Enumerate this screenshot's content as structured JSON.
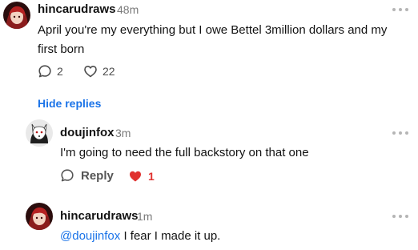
{
  "comments": [
    {
      "username": "hincarudraws",
      "time": "48m",
      "text": "April you're my everything but I owe Bettel 3million dollars and my first born",
      "reply_count": "2",
      "like_count": "22",
      "avatar_icon": "avatar-anime-red-hair"
    },
    {
      "username": "doujinfox",
      "time": "3m",
      "text": "I'm going to need the full backstory on that one",
      "reply_label": "Reply",
      "like_count": "1",
      "liked": true,
      "avatar_icon": "avatar-white-fox"
    },
    {
      "username": "hincarudraws",
      "time": "1m",
      "mention": "@doujinfox",
      "text": " I fear I made it up.",
      "avatar_icon": "avatar-anime-red-hair"
    }
  ],
  "thread": {
    "hide_replies_label": "Hide replies"
  },
  "colors": {
    "link": "#1a73e8",
    "liked": "#e0312f",
    "muted": "#7a7a7a"
  }
}
